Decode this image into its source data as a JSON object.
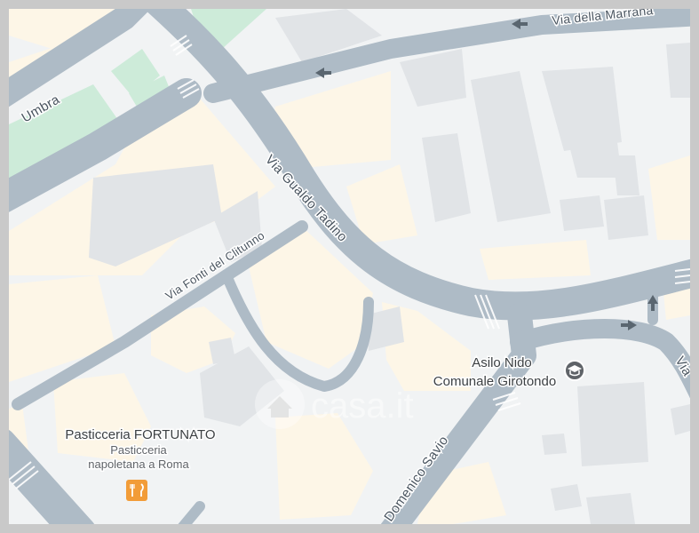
{
  "streets": {
    "via_della_marrana": "Via della Marrana",
    "umbra": "Umbra",
    "via_gualdo_tadino": "Via Gualdo Tadino",
    "via_fonti_del_clitunno": "Via Fonti del Clitunno",
    "domenico_savio": "Domenico Savio",
    "via_right_edge": "Via"
  },
  "pois": {
    "asilo": {
      "line1": "Asilo Nido",
      "line2": "Comunale Girotondo",
      "icon": "school-icon",
      "color": "#5f6368"
    },
    "pasticceria": {
      "name": "Pasticceria FORTUNATO",
      "desc_line1": "Pasticceria",
      "desc_line2": "napoletana a Roma",
      "icon": "restaurant-icon",
      "color": "#f29c38"
    }
  },
  "watermark": {
    "text": "casa.it"
  },
  "colors": {
    "background": "#f1f3f4",
    "road": "#aebbc6",
    "block": "#fdf6e7",
    "building": "#e1e4e7",
    "park": "#cdebd9"
  }
}
